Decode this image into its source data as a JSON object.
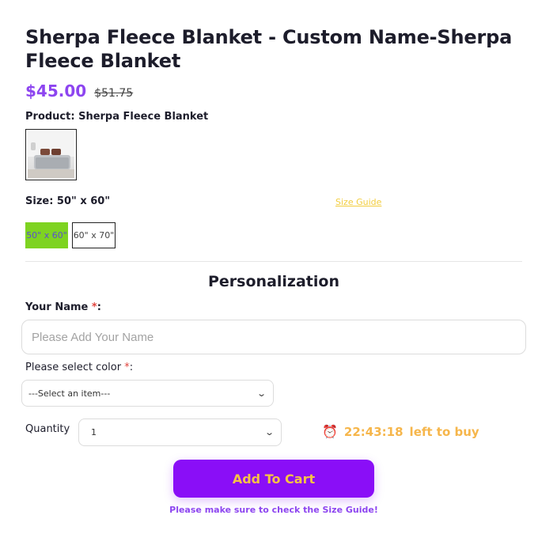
{
  "product": {
    "title": "Sherpa Fleece Blanket - Custom Name-Sherpa Fleece Blanket",
    "price": "$45.00",
    "old_price": "$51.75",
    "product_label": "Product: Sherpa Fleece Blanket"
  },
  "size": {
    "label": "Size: 50\" x 60\"",
    "guide_link": "Size Guide",
    "options": [
      {
        "label": "50\" x 60\"",
        "selected": true
      },
      {
        "label": "60\" x 70\"",
        "selected": false
      }
    ],
    "selected_color": "#7ed321"
  },
  "personalization": {
    "title": "Personalization",
    "name_label": "Your Name ",
    "name_required": "*",
    "name_suffix": ":",
    "name_placeholder": "Please Add Your Name",
    "color_label": "Please select color ",
    "color_required": "*",
    "color_suffix": ":",
    "color_selected": "---Select an item---"
  },
  "quantity": {
    "label": "Quantity",
    "value": "1"
  },
  "timer": {
    "icon": "alarm-clock-icon",
    "time": "22:43:18",
    "text": "left to buy"
  },
  "cart": {
    "button_label": "Add To Cart",
    "note": "Please make sure to check the Size Guide!",
    "accent": "#8a0ef7",
    "label_color": "#f6c344"
  }
}
